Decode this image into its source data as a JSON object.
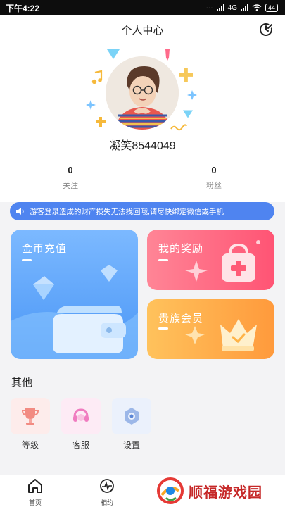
{
  "status_bar": {
    "time": "下午4:22",
    "network": "4G",
    "battery": "44"
  },
  "header": {
    "title": "个人中心",
    "action_icon": "edit-clock-icon"
  },
  "profile": {
    "username": "凝笑8544049"
  },
  "stats": [
    {
      "value": "0",
      "label": "关注"
    },
    {
      "value": "0",
      "label": "粉丝"
    }
  ],
  "notice": {
    "icon": "speaker-icon",
    "text": "游客登录造成的财产损失无法找回哦,请尽快绑定微信或手机"
  },
  "cards": {
    "coin": {
      "title": "金币充值",
      "icon": "wallet-icon"
    },
    "reward": {
      "title": "我的奖励",
      "icon": "gift-icon"
    },
    "vip": {
      "title": "贵族会员",
      "icon": "crown-icon"
    }
  },
  "other": {
    "title": "其他",
    "items": [
      {
        "label": "等级",
        "icon": "trophy-icon"
      },
      {
        "label": "客服",
        "icon": "headset-icon"
      },
      {
        "label": "设置",
        "icon": "settings-icon"
      }
    ]
  },
  "tabbar": [
    {
      "label": "首页",
      "icon": "home-icon"
    },
    {
      "label": "相约",
      "icon": "pulse-icon"
    }
  ],
  "watermark": {
    "text": "顺福游戏园"
  },
  "colors": {
    "notice_blue": "#4f84f0",
    "coin_card": "#5aa3fa",
    "reward_card": "#ff6a82",
    "vip_card": "#ffac48",
    "watermark_red": "#c62828"
  }
}
